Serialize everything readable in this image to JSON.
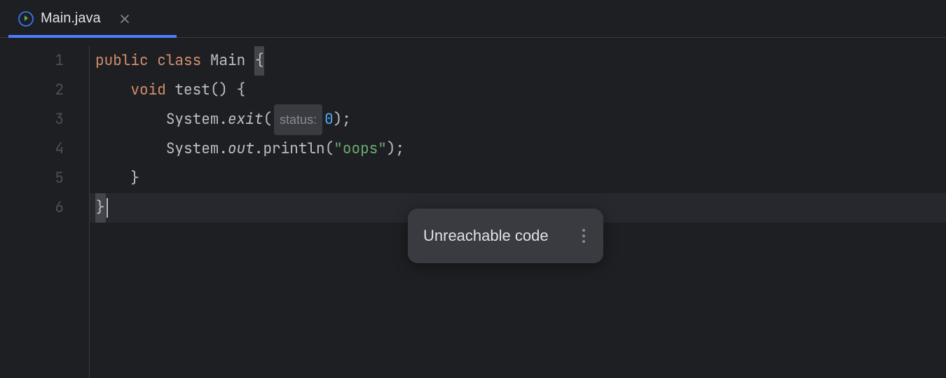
{
  "tab": {
    "filename": "Main.java"
  },
  "gutter": {
    "lines": [
      "1",
      "2",
      "3",
      "4",
      "5",
      "6"
    ]
  },
  "code": {
    "line1": {
      "public": "public",
      "class": "class",
      "name": "Main",
      "brace": "{"
    },
    "line2": {
      "indent": "    ",
      "void": "void",
      "method": "test",
      "parens_brace": "() {"
    },
    "line3": {
      "indent": "        ",
      "system": "System",
      "dot1": ".",
      "exit": "exit",
      "open": "(",
      "hint": "status:",
      "zero": "0",
      "close": ");"
    },
    "line4": {
      "indent": "        ",
      "system": "System",
      "dot1": ".",
      "out": "out",
      "dot2": ".",
      "println": "println",
      "open": "(",
      "str": "\"oops\"",
      "close": ");"
    },
    "line5": {
      "indent": "    ",
      "brace": "}"
    },
    "line6": {
      "brace": "}"
    }
  },
  "tooltip": {
    "message": "Unreachable code"
  }
}
